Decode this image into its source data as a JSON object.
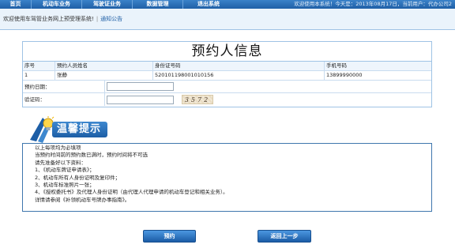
{
  "nav": {
    "items": [
      "首页",
      "机动车业务",
      "驾驶证业务",
      "数据管理",
      "退出系统"
    ],
    "welcome": "欢迎使用本系统！今天是：2013年08月17日，当前用户：代办公司2"
  },
  "notice": {
    "text": "欢迎使用车驾管业务网上预受理系统!",
    "separator": "|",
    "link": "通知公告"
  },
  "form": {
    "title": "预约人信息",
    "table": {
      "headers": [
        "序号",
        "预约人员姓名",
        "身份证号码",
        "手机号码"
      ],
      "rows": [
        [
          "1",
          "张静",
          "520101198001010156",
          "13899990000"
        ]
      ]
    },
    "date_label": "预约日期：",
    "date_value": "",
    "captcha_label": "验证码：",
    "captcha_value": "",
    "captcha_text": "3572"
  },
  "tips": {
    "title": "温馨提示",
    "lines": [
      "以上每项均为必填项",
      "当预约时间前的预约数已满时，预约时间将不可选",
      "请先准备好以下资料：",
      "1、《机动车牌证申请表》；",
      "2、机动车所有人身份证明及复印件；",
      "3、机动车标准照片一张；",
      "4、《授权委托书》及代理人身份证明（由代理人代理申请的机动车登记和相关业务）。",
      "详情请参阅《补领机动车号牌办事指南》。"
    ]
  },
  "buttons": {
    "submit": "预约",
    "back": "返回上一步"
  },
  "colors": {
    "nav": "#1f5fa6",
    "accent": "#3f76ad",
    "border": "#9fc3e5"
  }
}
